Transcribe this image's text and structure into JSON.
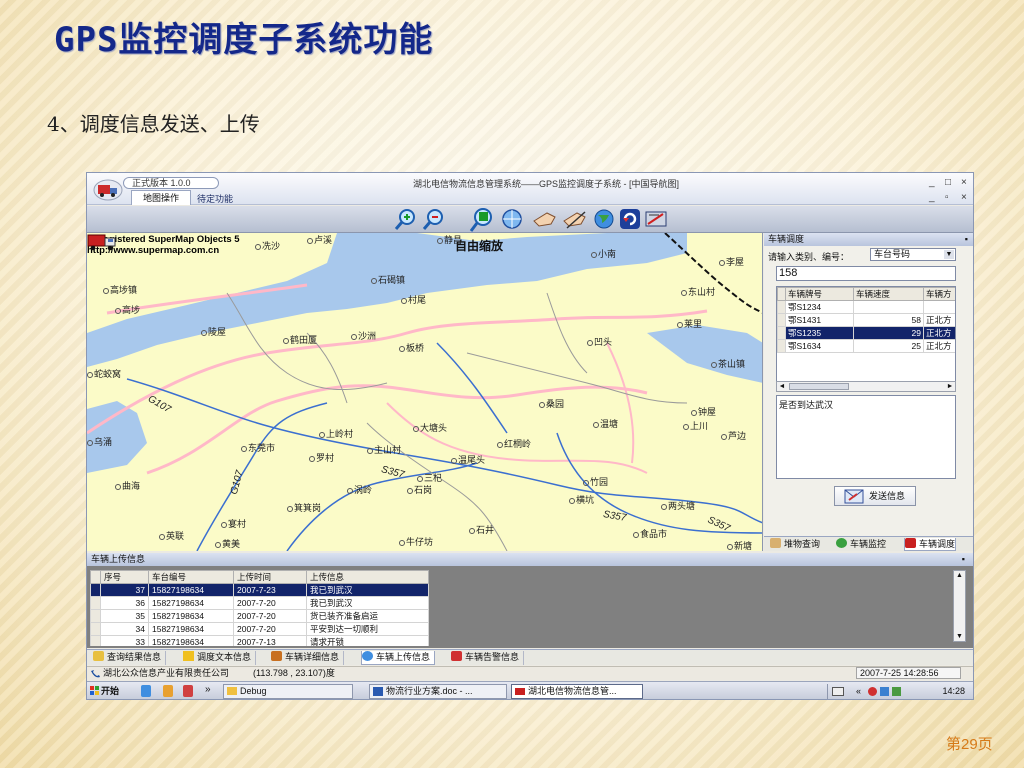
{
  "slide": {
    "title": "GPS监控调度子系统功能",
    "subtitle": "4、调度信息发送、上传",
    "page": "第29页"
  },
  "app": {
    "window_title": "湖北电信物流信息管理系统——GPS监控调度子系统 - [中国导航图]",
    "version": "正式版本 1.0.0",
    "tabs": [
      "地图操作",
      "待定功能"
    ],
    "window_controls": [
      "_",
      "□",
      "×",
      "_",
      "▫",
      "×"
    ],
    "toolbar_icons": [
      "zoom-in-icon",
      "zoom-out-icon",
      "free-zoom-icon",
      "full-extent-icon",
      "pan-hand-icon",
      "measure-icon",
      "globe-icon",
      "refresh-icon",
      "layer-icon"
    ],
    "free_zoom_label": "自由缩放",
    "map": {
      "watermark_line1": "Unregistered SuperMap Objects 5",
      "watermark_line2": "http://www.supermap.com.cn",
      "places": [
        "冼沙",
        "卢溪",
        "静昌",
        "小南",
        "李屋",
        "高埗镇",
        "石碣镇",
        "东山村",
        "高埗",
        "村尾",
        "莱里",
        "陵屋",
        "鹤田厦",
        "沙洲",
        "凹头",
        "板桥",
        "茶山镇",
        "蛇蛟窝",
        "钟屋",
        "上岭村",
        "大塘头",
        "桑园",
        "温塘",
        "上川",
        "芦边",
        "乌涌",
        "东莞市",
        "主山村",
        "红桐岭",
        "温尾头",
        "罗村",
        "三杞",
        "竹园",
        "曲海",
        "涡岭",
        "石岗",
        "横坑",
        "箕箕岗",
        "两头塘",
        "牛仔坊",
        "石井",
        "英联",
        "宴村",
        "黄美",
        "食品市",
        "新塘"
      ],
      "roads": [
        "G107",
        "G107",
        "S357",
        "S357",
        "S357"
      ]
    },
    "dispatch_panel": {
      "title": "车辆调度",
      "pin": "▪",
      "hint": "请输入类别、编号：",
      "category": "车台号码",
      "plate_input": "158",
      "columns": [
        "车辆牌号",
        "车辆速度",
        "车辆方"
      ],
      "rows": [
        {
          "plate": "鄂S1234",
          "speed": "",
          "dir": ""
        },
        {
          "plate": "鄂S1431",
          "speed": "58",
          "dir": "正北方"
        },
        {
          "plate": "鄂S1235",
          "speed": "29",
          "dir": "正北方"
        },
        {
          "plate": "鄂S1634",
          "speed": "25",
          "dir": "正北方"
        }
      ],
      "selected_row": 2,
      "message": "是否到达武汉",
      "send_label": "发送信息",
      "tabs": [
        "堆物查询",
        "车辆监控",
        "车辆调度"
      ]
    },
    "upload_panel": {
      "title": "车辆上传信息",
      "pin": "▪",
      "columns": [
        "序号",
        "车台编号",
        "上传时间",
        "上传信息"
      ],
      "rows": [
        {
          "seq": "37",
          "device": "15827198634",
          "time": "2007-7-23",
          "info": "我已到武汉"
        },
        {
          "seq": "36",
          "device": "15827198634",
          "time": "2007-7-20",
          "info": "我已到武汉"
        },
        {
          "seq": "35",
          "device": "15827198634",
          "time": "2007-7-20",
          "info": "货已装齐准备启运"
        },
        {
          "seq": "34",
          "device": "15827198634",
          "time": "2007-7-20",
          "info": "平安到达一切顺利"
        },
        {
          "seq": "33",
          "device": "15827198634",
          "time": "2007-7-13",
          "info": "请求开锁"
        }
      ],
      "selected_row": 0,
      "tabs": [
        "查询结果信息",
        "调度文本信息",
        "车辆详细信息",
        "车辆上传信息",
        "车辆告警信息"
      ],
      "active_tab": 3
    },
    "status": {
      "company": "湖北公众信息产业有限责任公司",
      "coords": "(113.798 , 23.107)度",
      "datetime": "2007-7-25 14:28:56"
    },
    "taskbar": {
      "start": "开始",
      "chevron": "»",
      "tasks": [
        "Debug",
        "物流行业方案.doc - ...",
        "湖北电信物流信息管..."
      ],
      "tray_chevron": "«",
      "clock": "14:28"
    },
    "colors": {
      "title": "#14288a",
      "page_number": "#d67a18",
      "map_land": "#fbfbc8",
      "river": "#ffc0cb",
      "water": "#a8c8ec",
      "selection": "#12246a"
    }
  }
}
